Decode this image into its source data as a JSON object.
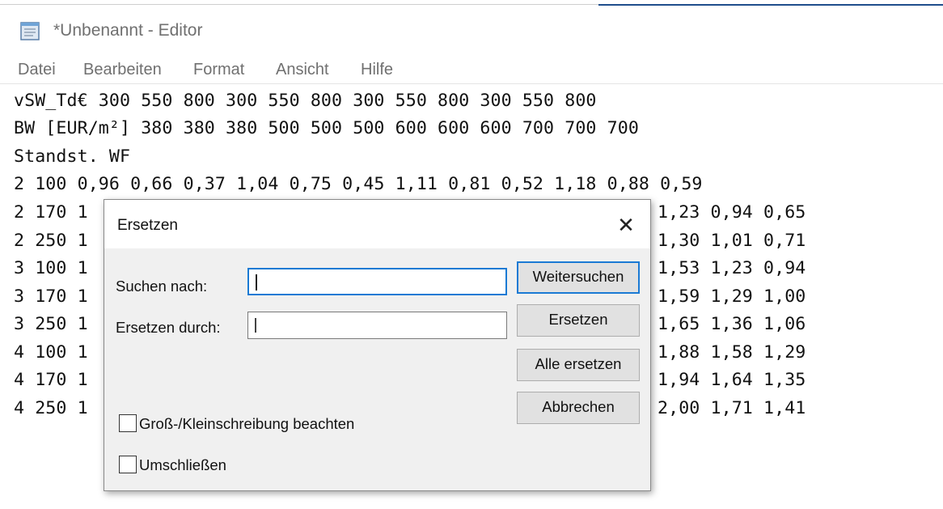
{
  "window": {
    "title": "*Unbenannt - Editor"
  },
  "menu": [
    "Datei",
    "Bearbeiten",
    "Format",
    "Ansicht",
    "Hilfe"
  ],
  "editor": {
    "lines": [
      "vSW_Td€ 300 550 800 300 550 800 300 550 800 300 550 800",
      "BW [EUR/m²] 380 380 380 500 500 500 600 600 600 700 700 700",
      "Standst. WF",
      "2 100 0,96 0,66 0,37 1,04 0,75 0,45 1,11 0,81 0,52 1,18 0,88 0,59",
      "2 170 1",
      "2 250 1",
      "3 100 1",
      "3 170 1",
      "3 250 1",
      "4 100 1",
      "4 170 1",
      "4 250 1"
    ],
    "right_fragments": [
      "1,23 0,94 0,65",
      "1,30 1,01 0,71",
      "1,53 1,23 0,94",
      "1,59 1,29 1,00",
      "1,65 1,36 1,06",
      "1,88 1,58 1,29",
      "1,94 1,64 1,35",
      "2,00 1,71 1,41"
    ]
  },
  "dialog": {
    "title": "Ersetzen",
    "close_icon": "close-icon",
    "find_label": "Suchen nach:",
    "find_value": "",
    "replace_label": "Ersetzen durch:",
    "replace_value": "",
    "buttons": {
      "find_next": "Weitersuchen",
      "replace": "Ersetzen",
      "replace_all": "Alle ersetzen",
      "cancel": "Abbrechen"
    },
    "options": {
      "match_case": "Groß-/Kleinschreibung beachten",
      "wrap": "Umschließen"
    }
  },
  "colors": {
    "accent": "#1a7ad4",
    "titlebar_text": "#707070"
  }
}
